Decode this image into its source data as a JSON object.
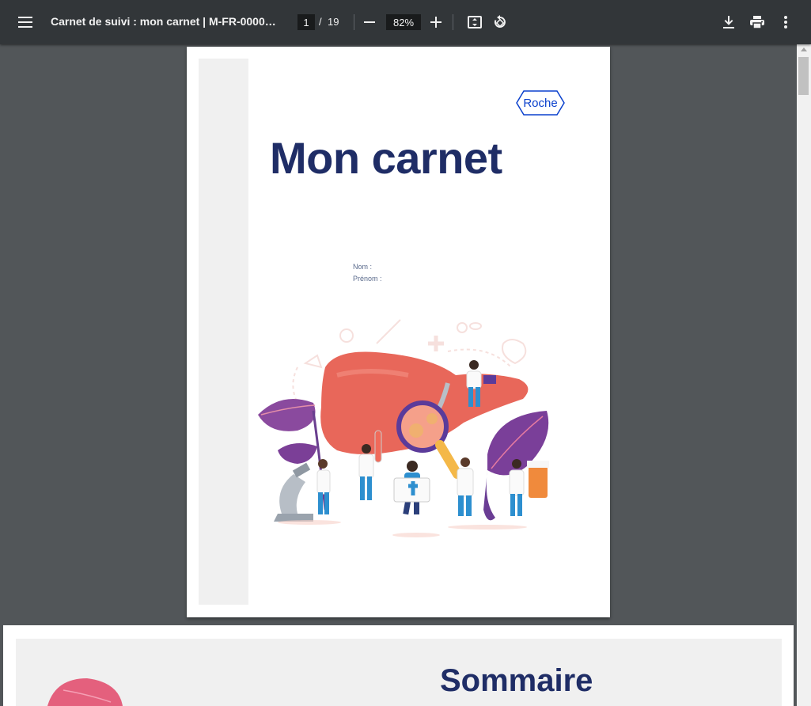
{
  "toolbar": {
    "title": "Carnet de suivi : mon carnet | M-FR-000067...",
    "page_current": "1",
    "page_separator": "/",
    "page_total": "19",
    "zoom": "82%"
  },
  "page1": {
    "logo_text": "Roche",
    "title": "Mon carnet",
    "name_label": "Nom :",
    "firstname_label": "Prénom :"
  },
  "page2": {
    "title": "Sommaire"
  },
  "icons": {
    "menu": "hamburger-menu-icon",
    "zoom_out": "minus-icon",
    "zoom_in": "plus-icon",
    "fit": "fit-to-page-icon",
    "rotate": "rotate-icon",
    "download": "download-icon",
    "print": "print-icon",
    "more": "more-vert-icon"
  },
  "colors": {
    "toolbar_bg": "#323639",
    "viewer_bg": "#525659",
    "title_navy": "#1f2d66",
    "roche_blue": "#0b41cd",
    "liver": "#e8675a"
  }
}
